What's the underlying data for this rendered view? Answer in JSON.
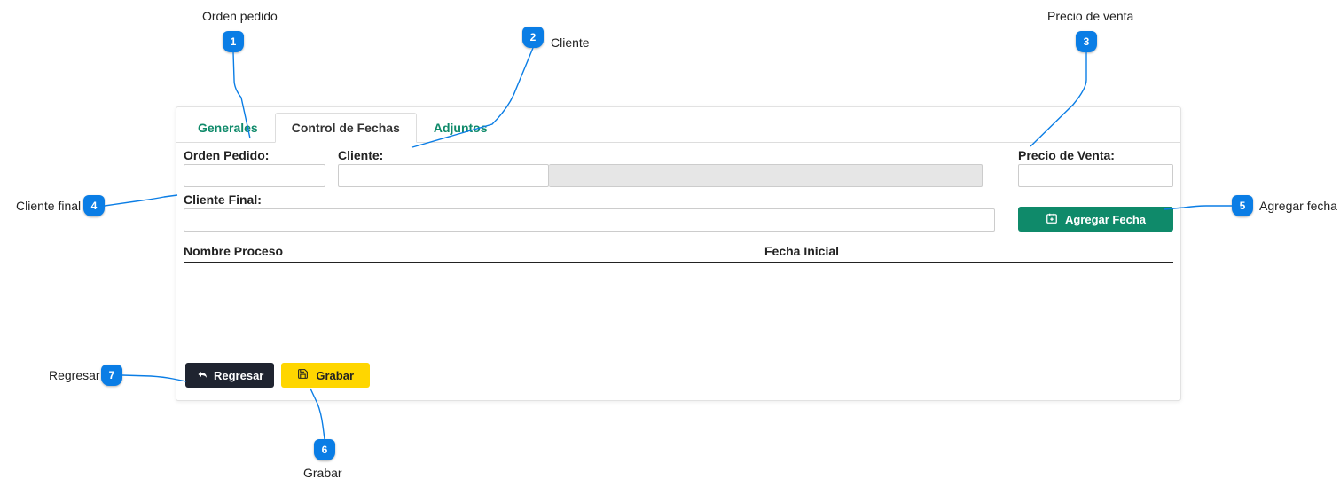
{
  "tabs": {
    "generales": "Generales",
    "control_fechas": "Control de Fechas",
    "adjuntos": "Adjuntos"
  },
  "form": {
    "orden_pedido_label": "Orden Pedido:",
    "cliente_label": "Cliente:",
    "precio_venta_label": "Precio de Venta:",
    "cliente_final_label": "Cliente Final:",
    "agregar_fecha_label": "Agregar Fecha"
  },
  "table": {
    "col_nombre": "Nombre Proceso",
    "col_fecha": "Fecha Inicial"
  },
  "footer": {
    "regresar_label": "Regresar",
    "grabar_label": "Grabar"
  },
  "callouts": [
    {
      "n": "1",
      "label": "Orden pedido"
    },
    {
      "n": "2",
      "label": "Cliente"
    },
    {
      "n": "3",
      "label": "Precio de venta"
    },
    {
      "n": "4",
      "label": "Cliente final"
    },
    {
      "n": "5",
      "label": "Agregar fecha"
    },
    {
      "n": "6",
      "label": "Grabar"
    },
    {
      "n": "7",
      "label": "Regresar"
    }
  ]
}
